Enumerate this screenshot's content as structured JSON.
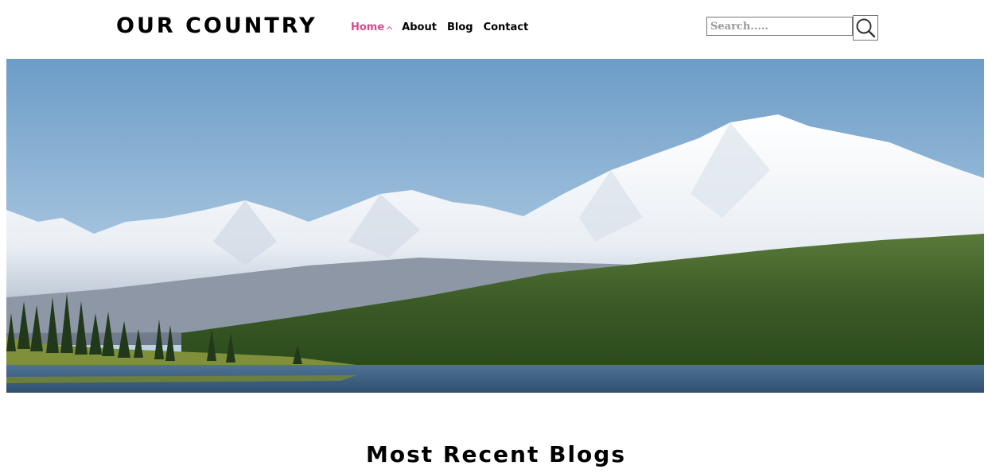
{
  "header": {
    "logo": "OUR COUNTRY",
    "nav": [
      {
        "label": "Home",
        "active": true
      },
      {
        "label": "About"
      },
      {
        "label": "Blog"
      },
      {
        "label": "Contact"
      }
    ],
    "search": {
      "placeholder": "Search.....",
      "value": ""
    }
  },
  "hero": {
    "subject": "snow-capped mountain range above a forested hillside and lake"
  },
  "main": {
    "section_title": "Most Recent Blogs"
  },
  "colors": {
    "accent": "#e0488b",
    "text": "#000000"
  },
  "icons": {
    "search": "search-icon",
    "caret": "chevron-up-icon"
  }
}
